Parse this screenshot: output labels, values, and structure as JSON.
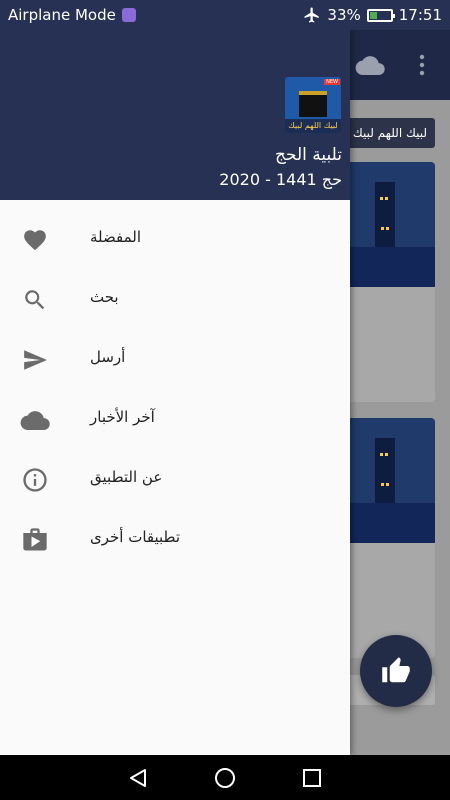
{
  "status_bar": {
    "mode": "Airplane Mode",
    "battery": "33%",
    "time": "17:51",
    "battery_level": 0.33
  },
  "app": {
    "title_chip": "لبيك اللهم لبيك"
  },
  "drawer": {
    "app_icon_text": "لبيك اللهم لبيك",
    "app_icon_badge": "NEW",
    "title": "تلبية الحج",
    "subtitle": "حج 1441 - 2020",
    "items": [
      {
        "label": "المفضلة",
        "icon": "heart-icon"
      },
      {
        "label": "بحث",
        "icon": "search-icon"
      },
      {
        "label": "أرسل",
        "icon": "send-icon"
      },
      {
        "label": "آخر الأخبار",
        "icon": "cloud-icon"
      },
      {
        "label": "عن التطبيق",
        "icon": "info-icon"
      },
      {
        "label": "تطبيقات أخرى",
        "icon": "shop-icon"
      }
    ]
  },
  "colors": {
    "header": "#263153",
    "drawer_bg": "#fafafa",
    "icon": "#6b6b6b"
  }
}
